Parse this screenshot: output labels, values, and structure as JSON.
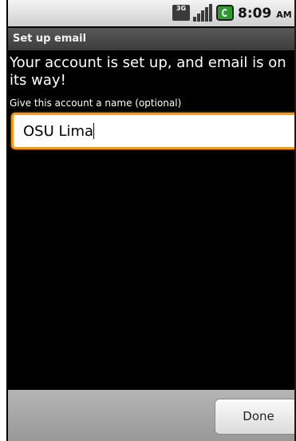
{
  "status_bar": {
    "network_label": "3G",
    "time": "8:09",
    "am_pm": "AM",
    "icons": [
      "3g-icon",
      "signal-icon",
      "battery-charging-icon"
    ]
  },
  "title_bar": {
    "title": "Set up email"
  },
  "content": {
    "message": "Your account is set up, and email is on its way!",
    "name_label": "Give this account a name (optional)",
    "account_name_value": "OSU Lima"
  },
  "bottom_bar": {
    "done_label": "Done"
  },
  "colors": {
    "focus_border": "#f39a1c",
    "background": "#000000",
    "title_bar": "#4a4a4a"
  }
}
